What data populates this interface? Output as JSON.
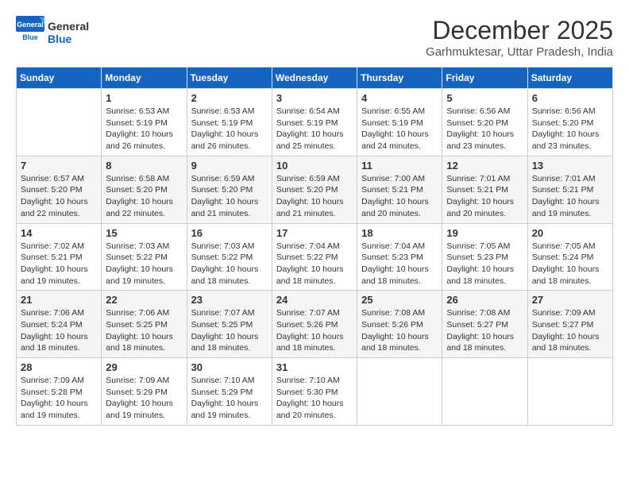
{
  "header": {
    "logo_general": "General",
    "logo_blue": "Blue",
    "month_title": "December 2025",
    "subtitle": "Garhmuktesar, Uttar Pradesh, India"
  },
  "weekdays": [
    "Sunday",
    "Monday",
    "Tuesday",
    "Wednesday",
    "Thursday",
    "Friday",
    "Saturday"
  ],
  "weeks": [
    [
      {
        "day": "",
        "sunrise": "",
        "sunset": "",
        "daylight": ""
      },
      {
        "day": "1",
        "sunrise": "Sunrise: 6:53 AM",
        "sunset": "Sunset: 5:19 PM",
        "daylight": "Daylight: 10 hours and 26 minutes."
      },
      {
        "day": "2",
        "sunrise": "Sunrise: 6:53 AM",
        "sunset": "Sunset: 5:19 PM",
        "daylight": "Daylight: 10 hours and 26 minutes."
      },
      {
        "day": "3",
        "sunrise": "Sunrise: 6:54 AM",
        "sunset": "Sunset: 5:19 PM",
        "daylight": "Daylight: 10 hours and 25 minutes."
      },
      {
        "day": "4",
        "sunrise": "Sunrise: 6:55 AM",
        "sunset": "Sunset: 5:19 PM",
        "daylight": "Daylight: 10 hours and 24 minutes."
      },
      {
        "day": "5",
        "sunrise": "Sunrise: 6:56 AM",
        "sunset": "Sunset: 5:20 PM",
        "daylight": "Daylight: 10 hours and 23 minutes."
      },
      {
        "day": "6",
        "sunrise": "Sunrise: 6:56 AM",
        "sunset": "Sunset: 5:20 PM",
        "daylight": "Daylight: 10 hours and 23 minutes."
      }
    ],
    [
      {
        "day": "7",
        "sunrise": "Sunrise: 6:57 AM",
        "sunset": "Sunset: 5:20 PM",
        "daylight": "Daylight: 10 hours and 22 minutes."
      },
      {
        "day": "8",
        "sunrise": "Sunrise: 6:58 AM",
        "sunset": "Sunset: 5:20 PM",
        "daylight": "Daylight: 10 hours and 22 minutes."
      },
      {
        "day": "9",
        "sunrise": "Sunrise: 6:59 AM",
        "sunset": "Sunset: 5:20 PM",
        "daylight": "Daylight: 10 hours and 21 minutes."
      },
      {
        "day": "10",
        "sunrise": "Sunrise: 6:59 AM",
        "sunset": "Sunset: 5:20 PM",
        "daylight": "Daylight: 10 hours and 21 minutes."
      },
      {
        "day": "11",
        "sunrise": "Sunrise: 7:00 AM",
        "sunset": "Sunset: 5:21 PM",
        "daylight": "Daylight: 10 hours and 20 minutes."
      },
      {
        "day": "12",
        "sunrise": "Sunrise: 7:01 AM",
        "sunset": "Sunset: 5:21 PM",
        "daylight": "Daylight: 10 hours and 20 minutes."
      },
      {
        "day": "13",
        "sunrise": "Sunrise: 7:01 AM",
        "sunset": "Sunset: 5:21 PM",
        "daylight": "Daylight: 10 hours and 19 minutes."
      }
    ],
    [
      {
        "day": "14",
        "sunrise": "Sunrise: 7:02 AM",
        "sunset": "Sunset: 5:21 PM",
        "daylight": "Daylight: 10 hours and 19 minutes."
      },
      {
        "day": "15",
        "sunrise": "Sunrise: 7:03 AM",
        "sunset": "Sunset: 5:22 PM",
        "daylight": "Daylight: 10 hours and 19 minutes."
      },
      {
        "day": "16",
        "sunrise": "Sunrise: 7:03 AM",
        "sunset": "Sunset: 5:22 PM",
        "daylight": "Daylight: 10 hours and 18 minutes."
      },
      {
        "day": "17",
        "sunrise": "Sunrise: 7:04 AM",
        "sunset": "Sunset: 5:22 PM",
        "daylight": "Daylight: 10 hours and 18 minutes."
      },
      {
        "day": "18",
        "sunrise": "Sunrise: 7:04 AM",
        "sunset": "Sunset: 5:23 PM",
        "daylight": "Daylight: 10 hours and 18 minutes."
      },
      {
        "day": "19",
        "sunrise": "Sunrise: 7:05 AM",
        "sunset": "Sunset: 5:23 PM",
        "daylight": "Daylight: 10 hours and 18 minutes."
      },
      {
        "day": "20",
        "sunrise": "Sunrise: 7:05 AM",
        "sunset": "Sunset: 5:24 PM",
        "daylight": "Daylight: 10 hours and 18 minutes."
      }
    ],
    [
      {
        "day": "21",
        "sunrise": "Sunrise: 7:06 AM",
        "sunset": "Sunset: 5:24 PM",
        "daylight": "Daylight: 10 hours and 18 minutes."
      },
      {
        "day": "22",
        "sunrise": "Sunrise: 7:06 AM",
        "sunset": "Sunset: 5:25 PM",
        "daylight": "Daylight: 10 hours and 18 minutes."
      },
      {
        "day": "23",
        "sunrise": "Sunrise: 7:07 AM",
        "sunset": "Sunset: 5:25 PM",
        "daylight": "Daylight: 10 hours and 18 minutes."
      },
      {
        "day": "24",
        "sunrise": "Sunrise: 7:07 AM",
        "sunset": "Sunset: 5:26 PM",
        "daylight": "Daylight: 10 hours and 18 minutes."
      },
      {
        "day": "25",
        "sunrise": "Sunrise: 7:08 AM",
        "sunset": "Sunset: 5:26 PM",
        "daylight": "Daylight: 10 hours and 18 minutes."
      },
      {
        "day": "26",
        "sunrise": "Sunrise: 7:08 AM",
        "sunset": "Sunset: 5:27 PM",
        "daylight": "Daylight: 10 hours and 18 minutes."
      },
      {
        "day": "27",
        "sunrise": "Sunrise: 7:09 AM",
        "sunset": "Sunset: 5:27 PM",
        "daylight": "Daylight: 10 hours and 18 minutes."
      }
    ],
    [
      {
        "day": "28",
        "sunrise": "Sunrise: 7:09 AM",
        "sunset": "Sunset: 5:28 PM",
        "daylight": "Daylight: 10 hours and 19 minutes."
      },
      {
        "day": "29",
        "sunrise": "Sunrise: 7:09 AM",
        "sunset": "Sunset: 5:29 PM",
        "daylight": "Daylight: 10 hours and 19 minutes."
      },
      {
        "day": "30",
        "sunrise": "Sunrise: 7:10 AM",
        "sunset": "Sunset: 5:29 PM",
        "daylight": "Daylight: 10 hours and 19 minutes."
      },
      {
        "day": "31",
        "sunrise": "Sunrise: 7:10 AM",
        "sunset": "Sunset: 5:30 PM",
        "daylight": "Daylight: 10 hours and 20 minutes."
      },
      {
        "day": "",
        "sunrise": "",
        "sunset": "",
        "daylight": ""
      },
      {
        "day": "",
        "sunrise": "",
        "sunset": "",
        "daylight": ""
      },
      {
        "day": "",
        "sunrise": "",
        "sunset": "",
        "daylight": ""
      }
    ]
  ]
}
